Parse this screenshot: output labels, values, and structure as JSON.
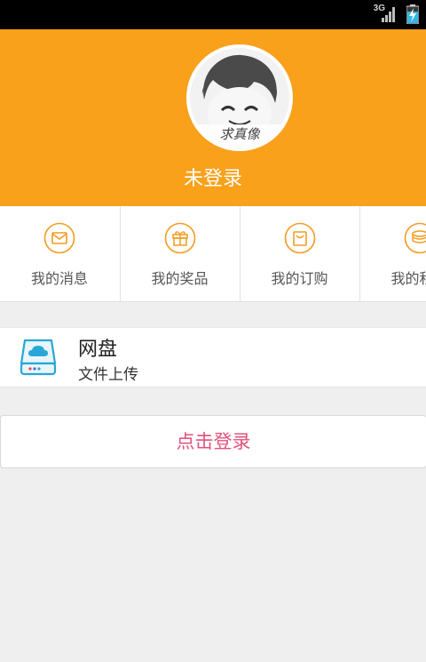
{
  "status_bar": {
    "network": "3G",
    "signal_icon": "signal-icon",
    "battery_icon": "battery-charging-icon"
  },
  "header": {
    "background_color": "#f9a11b",
    "avatar_caption": "求真像",
    "user_name": "未登录"
  },
  "quick_actions": [
    {
      "label": "我的消息",
      "icon": "message-icon"
    },
    {
      "label": "我的奖品",
      "icon": "gift-icon"
    },
    {
      "label": "我的订购",
      "icon": "bag-icon"
    },
    {
      "label": "我的积分",
      "icon": "coins-icon"
    }
  ],
  "cloud_disk": {
    "title": "网盘",
    "subtitle": "文件上传",
    "icon": "cloud-disk-icon"
  },
  "login_button": {
    "label": "点击登录",
    "color": "#e2517b"
  }
}
